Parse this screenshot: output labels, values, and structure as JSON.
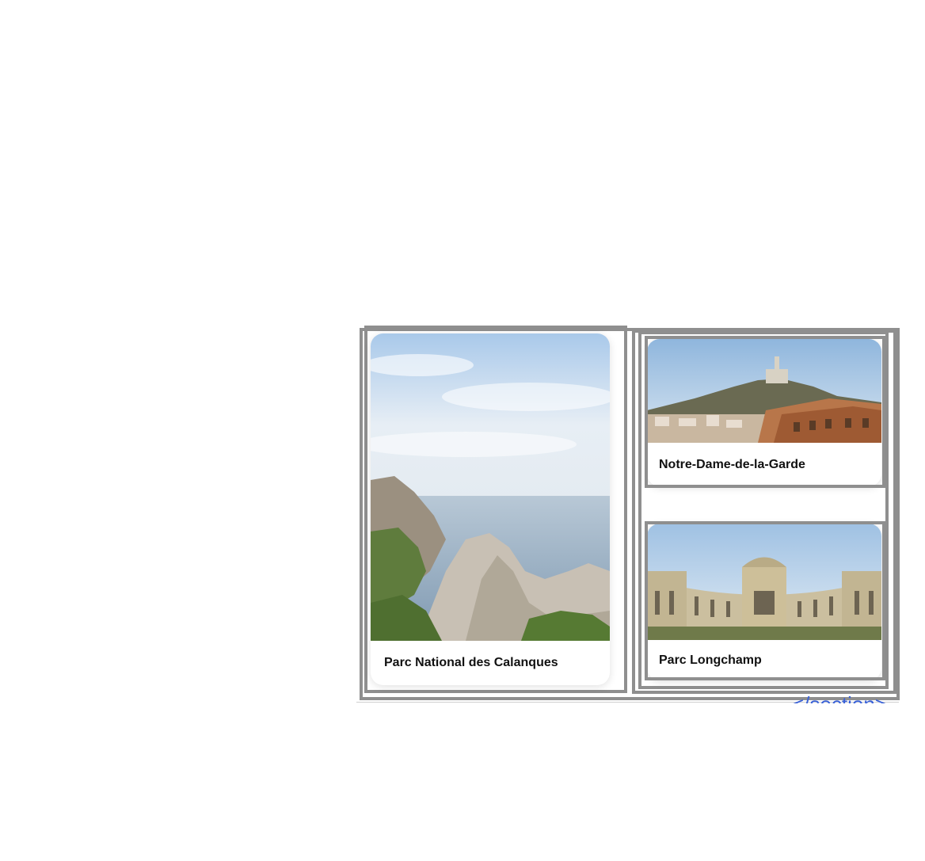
{
  "gallery": {
    "cards": [
      {
        "title": "Parc National des Calanques",
        "image": "calanques-coast-photo"
      },
      {
        "title": "Notre-Dame-de-la-Garde",
        "image": "notre-dame-hill-photo"
      },
      {
        "title": "Parc Longchamp",
        "image": "longchamp-palace-photo"
      }
    ],
    "footer_code": "</section>"
  },
  "colors": {
    "frame": "#8f8f8f",
    "caption_text": "#111111",
    "code_text": "#3a62d8"
  }
}
